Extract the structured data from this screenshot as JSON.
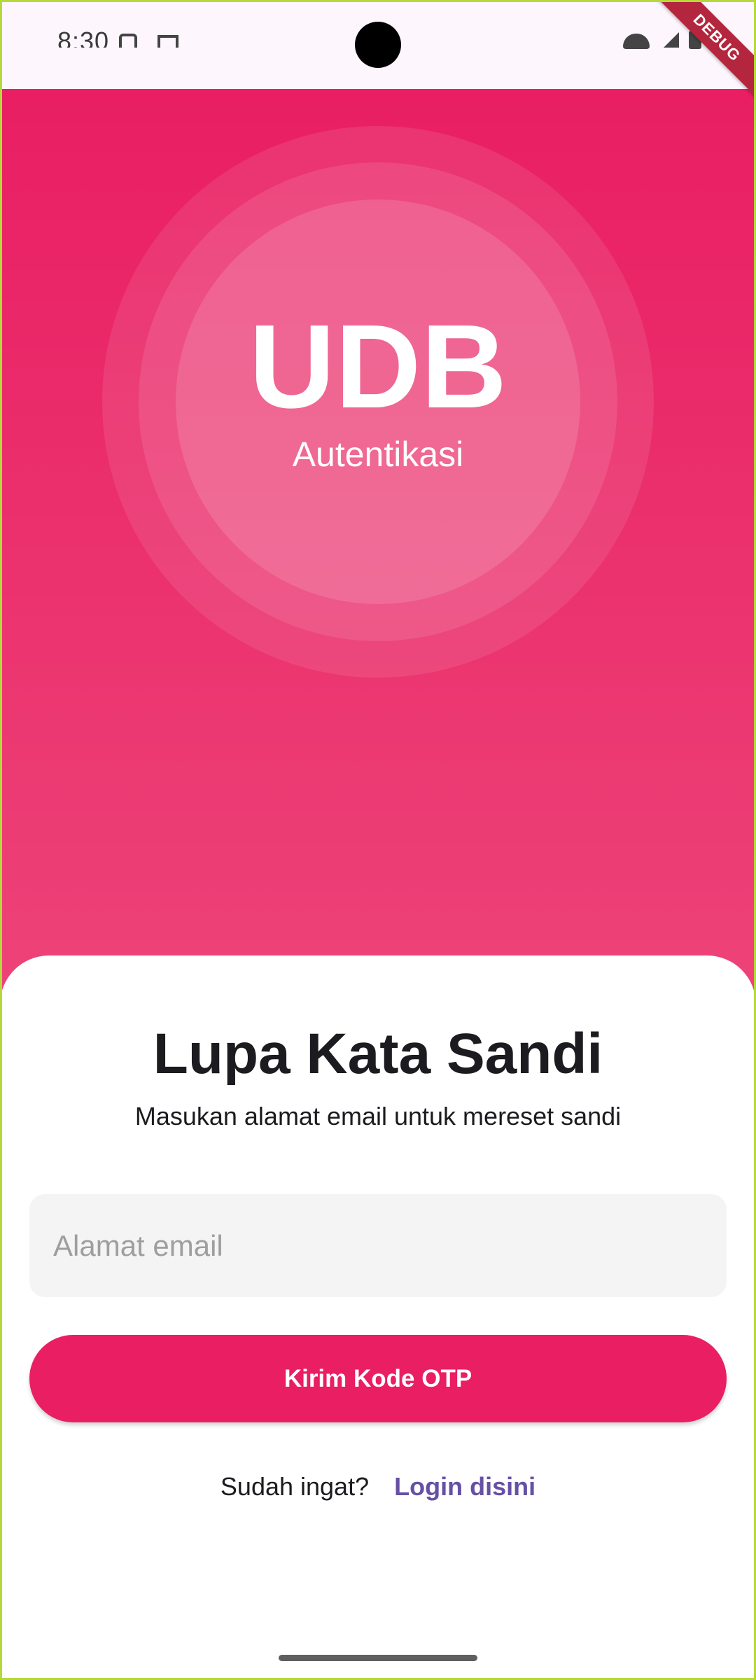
{
  "status_bar": {
    "time": "8:30"
  },
  "debug_banner": "DEBUG",
  "hero": {
    "logo": "UDB",
    "subtitle": "Autentikasi"
  },
  "form": {
    "title": "Lupa Kata Sandi",
    "subtitle": "Masukan alamat email untuk mereset sandi",
    "email_placeholder": "Alamat email",
    "email_value": "",
    "submit_label": "Kirim Kode OTP",
    "login_prompt": "Sudah ingat?",
    "login_link": "Login disini"
  },
  "colors": {
    "primary": "#e91e63",
    "link": "#6650a4",
    "input_background": "#f4f4f4"
  }
}
